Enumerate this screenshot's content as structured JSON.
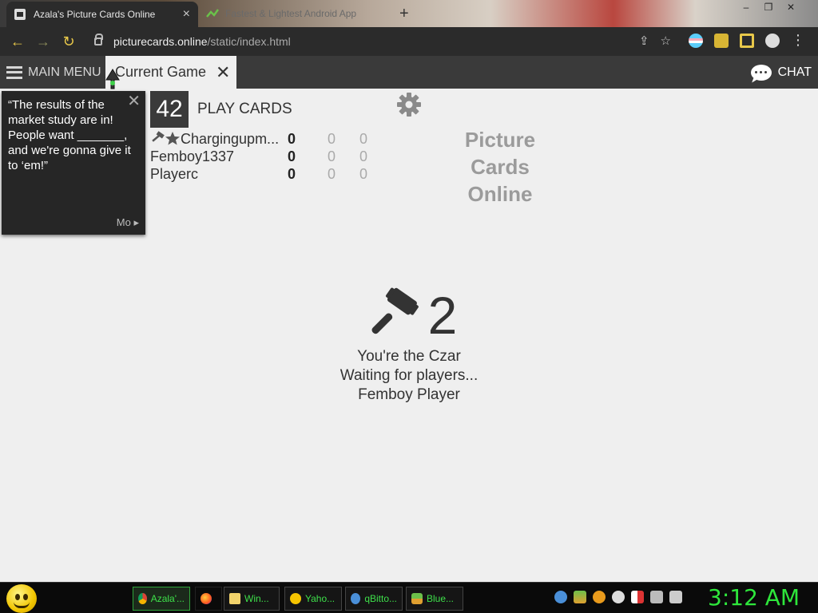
{
  "browser": {
    "active_tab_title": "Azala's Picture Cards Online",
    "second_tab_title": "Fastest & Lightest Android App",
    "url_domain": "picturecards.online",
    "url_path": "/static/index.html"
  },
  "appbar": {
    "main_menu_label": "MAIN MENU",
    "current_tab_label": "Current Game",
    "chat_label": "CHAT"
  },
  "black_card": {
    "text": "“The results of the market study are in! People want _______, and we're gonna give it to ‘em!”",
    "more_label": "Mo"
  },
  "game": {
    "cards_count": "42",
    "play_cards_label": "PLAY CARDS",
    "logo_lines": [
      "Picture",
      "Cards",
      "Online"
    ],
    "players": [
      {
        "name": "Chargingupm...",
        "score": "0",
        "c2": "0",
        "c3": "0"
      },
      {
        "name": "Femboy1337",
        "score": "0",
        "c2": "0",
        "c3": "0"
      },
      {
        "name": "Playerc",
        "score": "0",
        "c2": "0",
        "c3": "0"
      }
    ],
    "czar_number": "2",
    "status_lines": [
      "You're the Czar",
      "Waiting for players...",
      "Femboy Player"
    ]
  },
  "taskbar": {
    "tasks": [
      {
        "label": "Azala'...",
        "icon": "chrome-icon"
      },
      {
        "label": "",
        "icon": "firefox-icon"
      },
      {
        "label": "Win...",
        "icon": "folder-icon"
      },
      {
        "label": "Yaho...",
        "icon": "yahoo-messenger-icon"
      },
      {
        "label": "qBitto...",
        "icon": "qbittorrent-icon"
      },
      {
        "label": "Blue...",
        "icon": "bluestacks-icon"
      }
    ],
    "clock": "3:12 AM"
  },
  "colors": {
    "chrome_dark": "#2b2b2b",
    "appbar": "#3a3a3a",
    "page_bg": "#efefef",
    "taskbar_text": "#3ee04a",
    "clock": "#2ee73b"
  }
}
